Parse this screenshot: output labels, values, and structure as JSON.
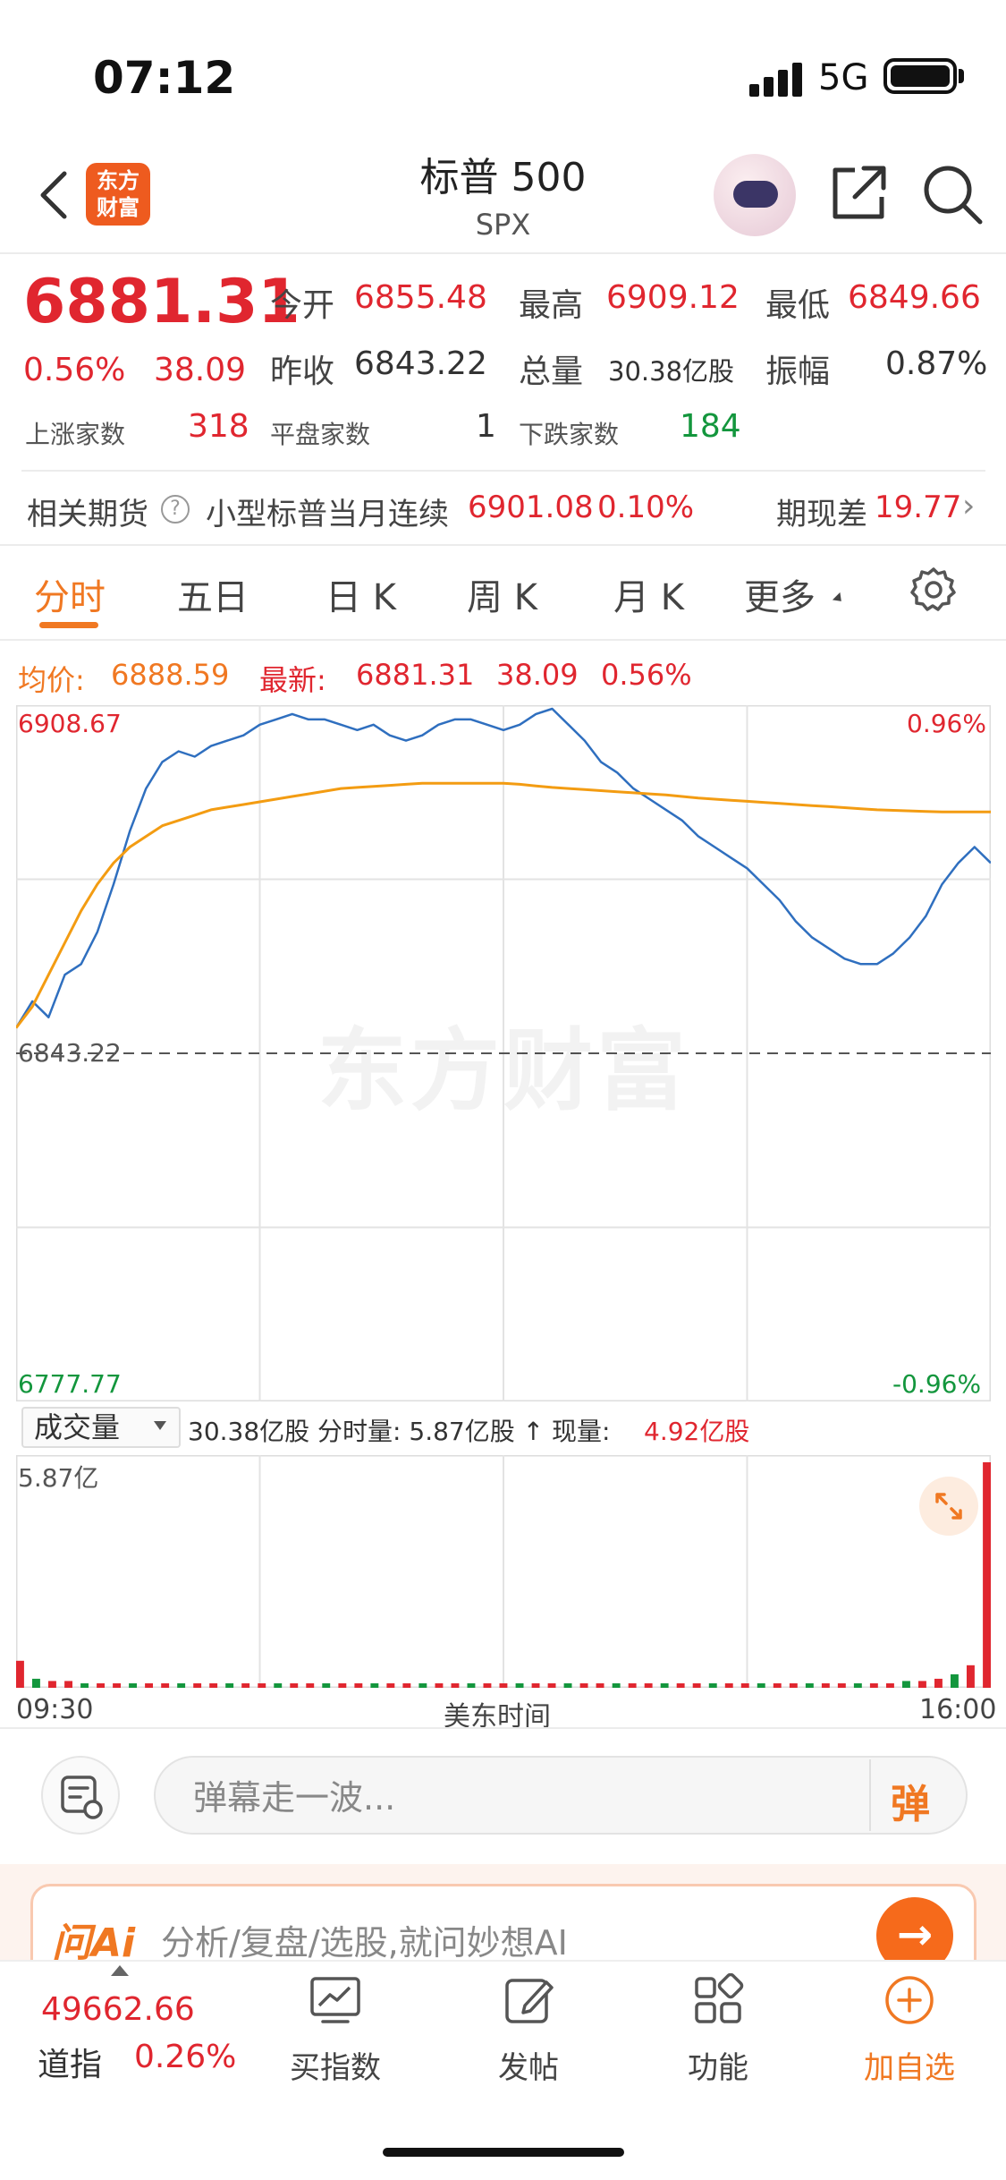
{
  "status_bar": {
    "time": "07:12",
    "network": "5G"
  },
  "header": {
    "logo_text": "东方财富",
    "title": "标普 500",
    "subtitle": "SPX"
  },
  "quote": {
    "price": "6881.31",
    "change_pct": "0.56%",
    "change_val": "38.09",
    "open_label": "今开",
    "open": "6855.48",
    "high_label": "最高",
    "high": "6909.12",
    "low_label": "最低",
    "low": "6849.66",
    "prev_close_label": "昨收",
    "prev_close": "6843.22",
    "volume_label": "总量",
    "volume": "30.38亿股",
    "amplitude_label": "振幅",
    "amplitude": "0.87%",
    "advancers_label": "上涨家数",
    "advancers": "318",
    "unchanged_label": "平盘家数",
    "unchanged": "1",
    "decliners_label": "下跌家数",
    "decliners": "184"
  },
  "futures": {
    "label": "相关期货",
    "name": "小型标普当月连续",
    "price": "6901.08",
    "pct": "0.10%",
    "basis_label": "期现差",
    "basis": "19.77"
  },
  "tabs": [
    "分时",
    "五日",
    "日 K",
    "周 K",
    "月 K",
    "更多"
  ],
  "active_tab": "分时",
  "chart_header": {
    "avg_label": "均价:",
    "avg": "6888.59",
    "latest_label": "最新:",
    "latest_price": "6881.31",
    "latest_chg": "38.09",
    "latest_pct": "0.56%"
  },
  "watermark": "东方财富",
  "chart_data": {
    "type": "line",
    "y_left_ticks": [
      "6908.67",
      "6843.22",
      "6777.77"
    ],
    "y_right_ticks": [
      "0.96%",
      "-0.96%"
    ],
    "ylim": [
      6777.77,
      6908.67
    ],
    "reference_line": 6843.22,
    "x_ticks": [
      "09:30",
      "美东时间",
      "16:00"
    ],
    "series": [
      {
        "color": "#2f6fbf",
        "values": [
          6848,
          6853,
          6850,
          6858,
          6860,
          6866,
          6875,
          6885,
          6893,
          6898,
          6900,
          6899,
          6901,
          6902,
          6903,
          6905,
          6906,
          6907,
          6906,
          6906,
          6905,
          6904,
          6905,
          6903,
          6902,
          6903,
          6905,
          6906,
          6906,
          6905,
          6904,
          6905,
          6907,
          6908,
          6905,
          6902,
          6898,
          6896,
          6893,
          6891,
          6889,
          6887,
          6884,
          6882,
          6880,
          6878,
          6875,
          6872,
          6868,
          6865,
          6863,
          6861,
          6860,
          6860,
          6862,
          6865,
          6869,
          6875,
          6879,
          6882,
          6879
        ]
      },
      {
        "color": "#f39c12",
        "values": [
          6848,
          6852,
          6858,
          6864,
          6870,
          6875,
          6879,
          6882,
          6884,
          6886,
          6887,
          6888,
          6889,
          6889.5,
          6890,
          6890.5,
          6891,
          6891.5,
          6892,
          6892.5,
          6893,
          6893.2,
          6893.4,
          6893.6,
          6893.8,
          6894,
          6894,
          6894,
          6894,
          6894,
          6894,
          6893.8,
          6893.5,
          6893.2,
          6893,
          6892.8,
          6892.6,
          6892.4,
          6892.2,
          6892,
          6891.8,
          6891.5,
          6891.2,
          6891,
          6890.8,
          6890.6,
          6890.4,
          6890.2,
          6890,
          6889.8,
          6889.6,
          6889.4,
          6889.2,
          6889,
          6888.9,
          6888.8,
          6888.7,
          6888.6,
          6888.6,
          6888.6,
          6888.59
        ]
      }
    ]
  },
  "volume": {
    "selector_label": "成交量",
    "info": "30.38亿股 分时量: 5.87亿股 ↑ 现量:",
    "current": "4.92亿股",
    "max_label": "5.87亿",
    "bars": [
      0.12,
      0.04,
      0.03,
      0.03,
      0.02,
      0.02,
      0.02,
      0.02,
      0.02,
      0.02,
      0.02,
      0.02,
      0.02,
      0.02,
      0.02,
      0.02,
      0.02,
      0.02,
      0.02,
      0.02,
      0.02,
      0.02,
      0.02,
      0.02,
      0.02,
      0.02,
      0.02,
      0.02,
      0.02,
      0.02,
      0.02,
      0.02,
      0.02,
      0.02,
      0.02,
      0.02,
      0.02,
      0.02,
      0.02,
      0.02,
      0.02,
      0.02,
      0.02,
      0.02,
      0.02,
      0.02,
      0.02,
      0.02,
      0.02,
      0.02,
      0.02,
      0.02,
      0.02,
      0.02,
      0.02,
      0.03,
      0.03,
      0.04,
      0.06,
      0.1,
      1.0
    ]
  },
  "danmaku": {
    "placeholder": "弹幕走一波...",
    "button": "弹"
  },
  "ai_bar": {
    "logo": "问Ai",
    "text": "分析/复盘/选股,就问妙想AI"
  },
  "bottom_nav": {
    "dji_price": "49662.66",
    "dji_name": "道指",
    "dji_pct": "0.26%",
    "items": [
      {
        "label": "买指数",
        "icon": "chart-trend-icon"
      },
      {
        "label": "发帖",
        "icon": "edit-icon"
      },
      {
        "label": "功能",
        "icon": "grid-icon"
      },
      {
        "label": "加自选",
        "icon": "add-circle-icon"
      }
    ]
  }
}
